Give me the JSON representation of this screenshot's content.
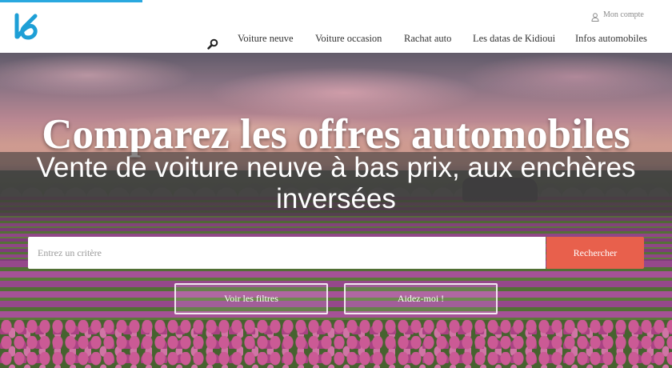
{
  "header": {
    "account_label": "Mon compte",
    "nav": [
      {
        "label": "Voiture neuve"
      },
      {
        "label": "Voiture occasion"
      },
      {
        "label": "Rachat auto"
      },
      {
        "label": "Les datas de Kidioui"
      },
      {
        "label": "Infos automobiles"
      }
    ]
  },
  "hero": {
    "title": "Comparez les offres automobiles",
    "search": {
      "placeholder": "Entrez un critère",
      "button_label": "Rechercher"
    },
    "actions": {
      "filters_label": "Voir les filtres",
      "help_label": "Aidez-moi !"
    }
  },
  "caption": {
    "text": "Vente de voiture neuve à bas prix, aux enchères inversées"
  },
  "icons": {
    "logo": "kidioui-logo",
    "search": "search-icon",
    "account": "user-icon"
  },
  "colors": {
    "brand": "#1e9fd6",
    "top_accent_line": "#2aa8df",
    "search_button": "#e8604c",
    "header_background": "#ffffff"
  }
}
